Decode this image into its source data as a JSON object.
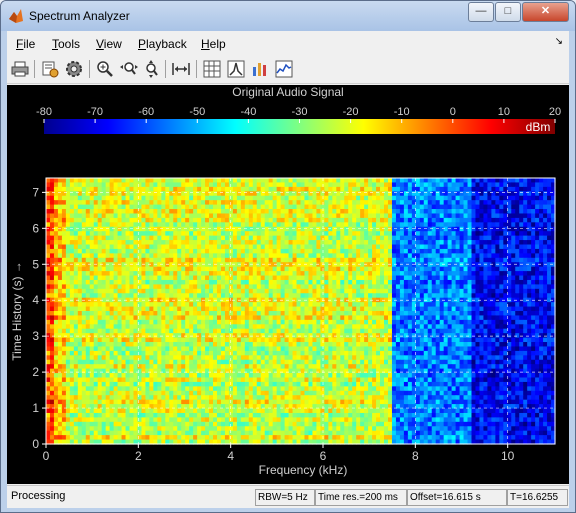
{
  "window": {
    "title": "Spectrum Analyzer"
  },
  "window_controls": {
    "minimize": "—",
    "maximize": "□",
    "close": "✕"
  },
  "menu": [
    {
      "key": "F",
      "rest": "ile"
    },
    {
      "key": "T",
      "rest": "ools"
    },
    {
      "key": "V",
      "rest": "iew"
    },
    {
      "key": "P",
      "rest": "layback"
    },
    {
      "key": "H",
      "rest": "elp"
    }
  ],
  "menu_dock_glyph": "↘",
  "toolbar_icons": [
    "print-icon",
    "run-settings-icon",
    "gear-icon",
    "zoom-in-icon",
    "zoom-x-icon",
    "zoom-y-icon",
    "scale-axes-icon",
    "spectrogram-icon",
    "peak-icon",
    "bar-chart-icon",
    "signal-icon"
  ],
  "colors": {
    "plot_bg": "#000000",
    "axis_fg": "#ffffff",
    "grid": "#ffffff",
    "dark_text": "#d0d0d0"
  },
  "chart_data": {
    "type": "heatmap",
    "title": "Original Audio Signal",
    "xlabel": "Frequency (kHz)",
    "ylabel": "Time History (s)  →",
    "x_ticks": [
      "0",
      "2",
      "4",
      "6",
      "8",
      "10"
    ],
    "y_ticks": [
      "0",
      "1",
      "2",
      "3",
      "4",
      "5",
      "6",
      "7"
    ],
    "xlim": [
      0,
      11.025
    ],
    "ylim": [
      0,
      7.4
    ],
    "colorbar": {
      "label": "dBm",
      "ticks": [
        "-80",
        "-70",
        "-60",
        "-50",
        "-40",
        "-30",
        "-20",
        "-10",
        "0",
        "10",
        "20"
      ],
      "range": [
        -80,
        20
      ],
      "colormap": "jet"
    },
    "grid": true,
    "spectral_regions": [
      {
        "from_khz": 0,
        "to_khz": 7.5,
        "level_dbm": -22
      },
      {
        "from_khz": 7.5,
        "to_khz": 9.2,
        "level_dbm": -55
      },
      {
        "from_khz": 9.2,
        "to_khz": 11.025,
        "level_dbm": -68
      }
    ]
  },
  "status": {
    "main": "Processing",
    "rbw": "RBW=5 Hz",
    "time_res": "Time res.=200 ms",
    "offset": "Offset=16.615 s",
    "t": "T=16.6255"
  }
}
